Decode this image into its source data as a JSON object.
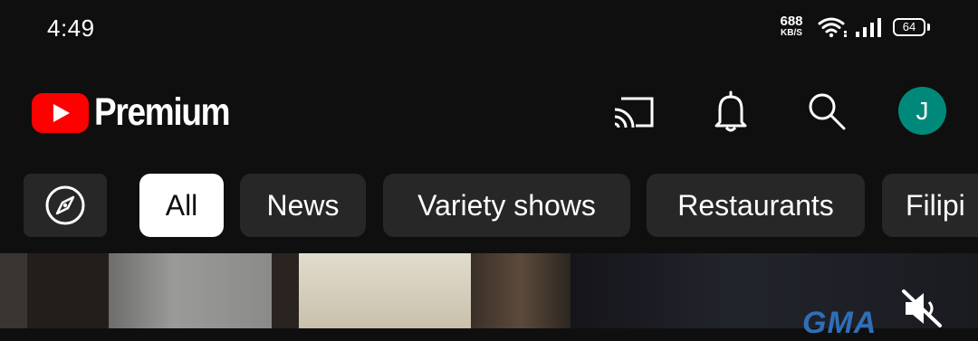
{
  "status_bar": {
    "time": "4:49",
    "net_speed_value": "688",
    "net_speed_unit": "KB/S",
    "battery_level": "64",
    "icons": [
      "wifi-icon",
      "signal-icon",
      "battery-icon"
    ]
  },
  "header": {
    "logo_text": "Premium",
    "avatar_initial": "J",
    "avatar_color": "#00897b",
    "icons": [
      "cast-icon",
      "bell-icon",
      "search-icon"
    ]
  },
  "chips": {
    "explore_icon": "compass-icon",
    "items": [
      {
        "label": "All",
        "selected": true
      },
      {
        "label": "News",
        "selected": false
      },
      {
        "label": "Variety shows",
        "selected": false
      },
      {
        "label": "Restaurants",
        "selected": false
      },
      {
        "label": "Filipi",
        "selected": false
      }
    ]
  },
  "video": {
    "watermark": "GMA",
    "mute_icon": "volume-off-icon"
  },
  "colors": {
    "background": "#0f0f0f",
    "chip_bg": "#272727",
    "chip_selected_bg": "#ffffff",
    "brand_red": "#ff0000"
  }
}
